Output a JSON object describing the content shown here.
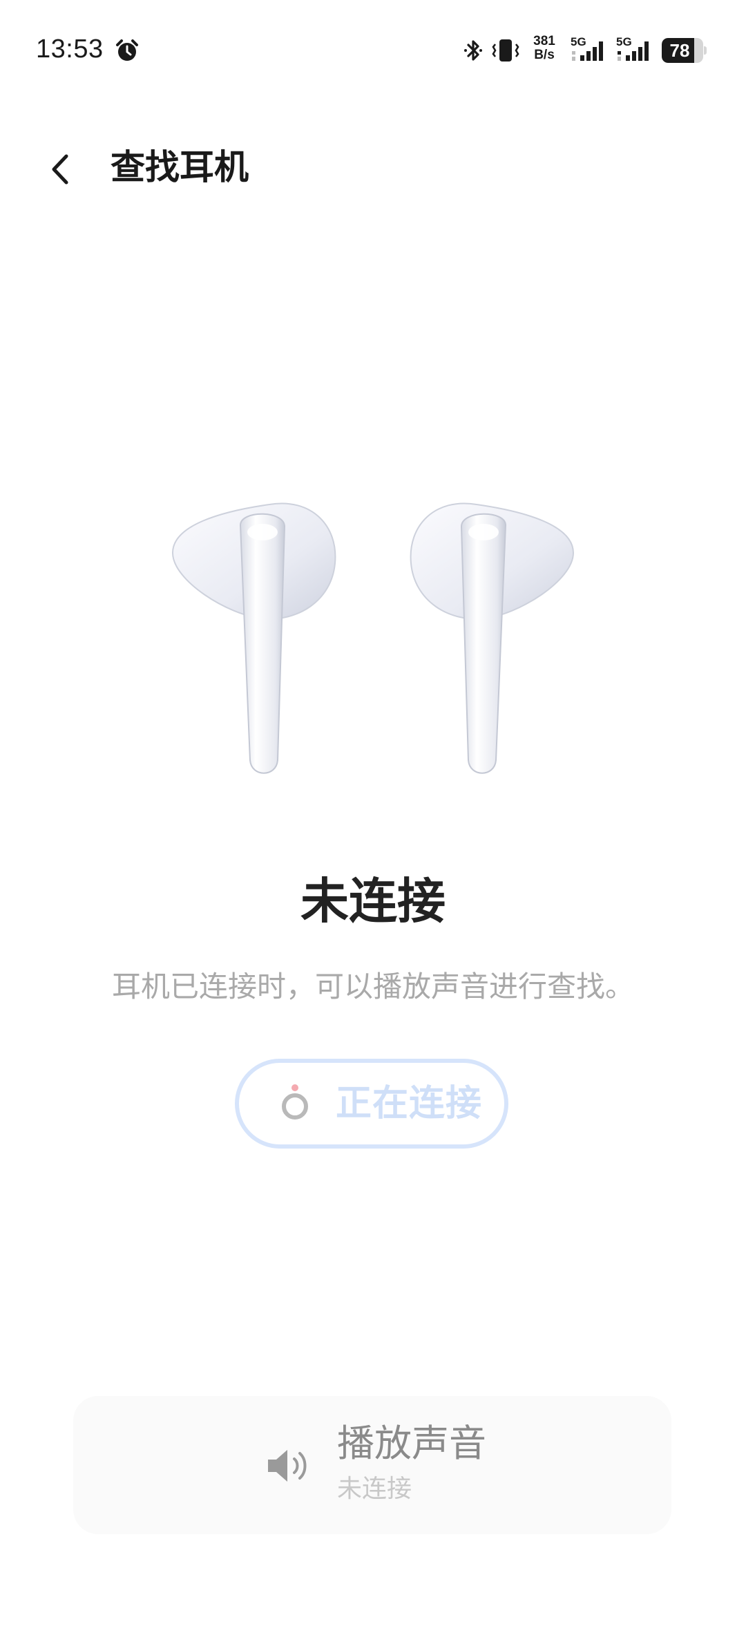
{
  "status_bar": {
    "time": "13:53",
    "net_speed_value": "381",
    "net_speed_unit": "B/s",
    "signal_1_label": "5G",
    "signal_2_label": "5G",
    "battery_level": "78",
    "battery_fraction": 0.78,
    "icons": [
      "alarm-icon",
      "bluetooth-icon",
      "vibrate-icon",
      "signal-icon",
      "battery-icon"
    ]
  },
  "header": {
    "title": "查找耳机",
    "back_icon": "chevron-left-icon"
  },
  "main": {
    "status_title": "未连接",
    "hint": "耳机已连接时，可以播放声音进行查找。",
    "connecting_button": {
      "label": "正在连接",
      "icon": "loading-spinner-icon",
      "border_color": "#d6e4fb",
      "text_color": "#cfdff8",
      "dot_color": "#f4aab0"
    }
  },
  "play_sound": {
    "title": "播放声音",
    "subtitle": "未连接",
    "icon": "speaker-icon"
  }
}
